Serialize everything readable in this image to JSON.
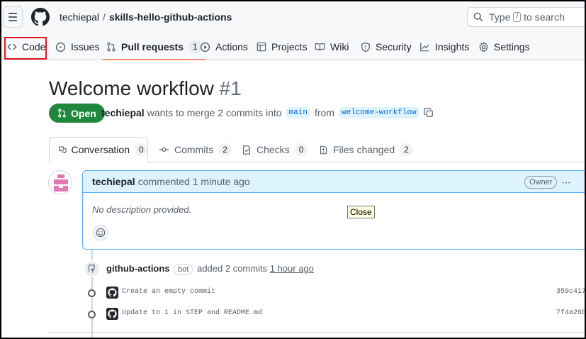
{
  "header": {
    "owner": "techiepal",
    "separator": "/",
    "repo": "skills-hello-github-actions",
    "search_prefix": "Type",
    "search_key": "/",
    "search_suffix": "to search"
  },
  "repo_nav": {
    "code": "Code",
    "issues": "Issues",
    "pull_requests": "Pull requests",
    "pull_requests_count": "1",
    "actions": "Actions",
    "projects": "Projects",
    "wiki": "Wiki",
    "security": "Security",
    "insights": "Insights",
    "settings": "Settings"
  },
  "pr": {
    "title": "Welcome workflow",
    "number": "#1",
    "state": "Open",
    "author": "techiepal",
    "meta_text": "wants to merge 2 commits into",
    "base_branch": "main",
    "from_text": "from",
    "head_branch": "welcome-workflow"
  },
  "tabs": {
    "conversation": "Conversation",
    "conversation_count": "0",
    "commits": "Commits",
    "commits_count": "2",
    "checks": "Checks",
    "checks_count": "0",
    "files_changed": "Files changed",
    "files_changed_count": "2"
  },
  "comment": {
    "author": "techiepal",
    "action": "commented 1 minute ago",
    "owner_badge": "Owner",
    "menu": "···",
    "body": "No description provided."
  },
  "tooltip": "Close",
  "event": {
    "author": "github-actions",
    "bot_badge": "bot",
    "action": "added 2 commits",
    "time": "1 hour ago"
  },
  "commits": [
    {
      "message": "Create an empty commit",
      "sha": "359c417"
    },
    {
      "message": "Update to 1 in STEP and README.md",
      "sha": "7f4a26b"
    }
  ],
  "colors": {
    "open_green": "#1f883d",
    "highlight_red": "#e0191f",
    "nav_underline": "#fd8c73",
    "comment_border": "#54aeff"
  }
}
